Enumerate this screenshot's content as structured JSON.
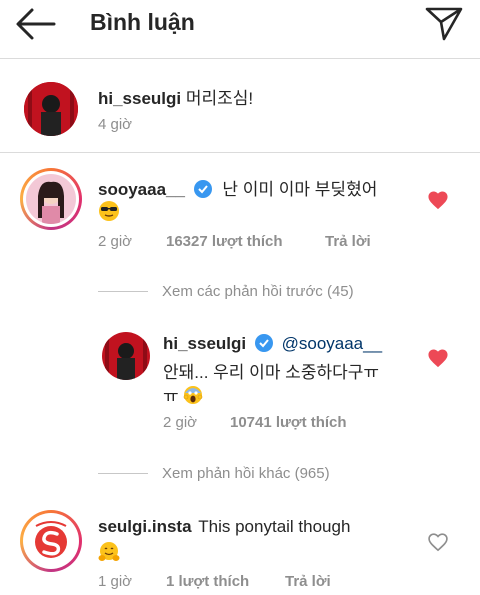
{
  "header": {
    "title": "Bình luận",
    "back_icon": "arrow-left-icon",
    "send_icon": "direct-send-icon"
  },
  "caption": {
    "username": "hi_sseulgi",
    "text": "머리조심!",
    "time": "4 giờ"
  },
  "comments": [
    {
      "username": "sooyaaa__",
      "verified": true,
      "text_line1": "난 이미 이마 부딪혔어",
      "emoji": "sunglasses-emoji",
      "time": "2 giờ",
      "likes": "16327 lượt thích",
      "reply": "Trả lời",
      "liked": true
    },
    {
      "view_previous": "Xem các phản hồi trước (45)"
    },
    {
      "username": "hi_sseulgi",
      "verified": true,
      "mention": "@sooyaaa__",
      "text_line2": "안돼... 우리 이마 소중하다구ㅠ",
      "text_line3": "ㅠ",
      "emoji": "screaming-face-emoji",
      "time": "2 giờ",
      "likes": "10741 lượt thích",
      "liked": true
    },
    {
      "view_more": "Xem phản hồi khác (965)"
    },
    {
      "username": "seulgi.insta",
      "text": "This ponytail though",
      "emoji": "hugging-face-emoji",
      "time": "1 giờ",
      "likes": "1 lượt thích",
      "reply": "Trả lời",
      "liked": false
    }
  ],
  "colors": {
    "accent_blue": "#3897f0",
    "heart_red": "#ed4956",
    "meta_gray": "#8e8e8e"
  }
}
